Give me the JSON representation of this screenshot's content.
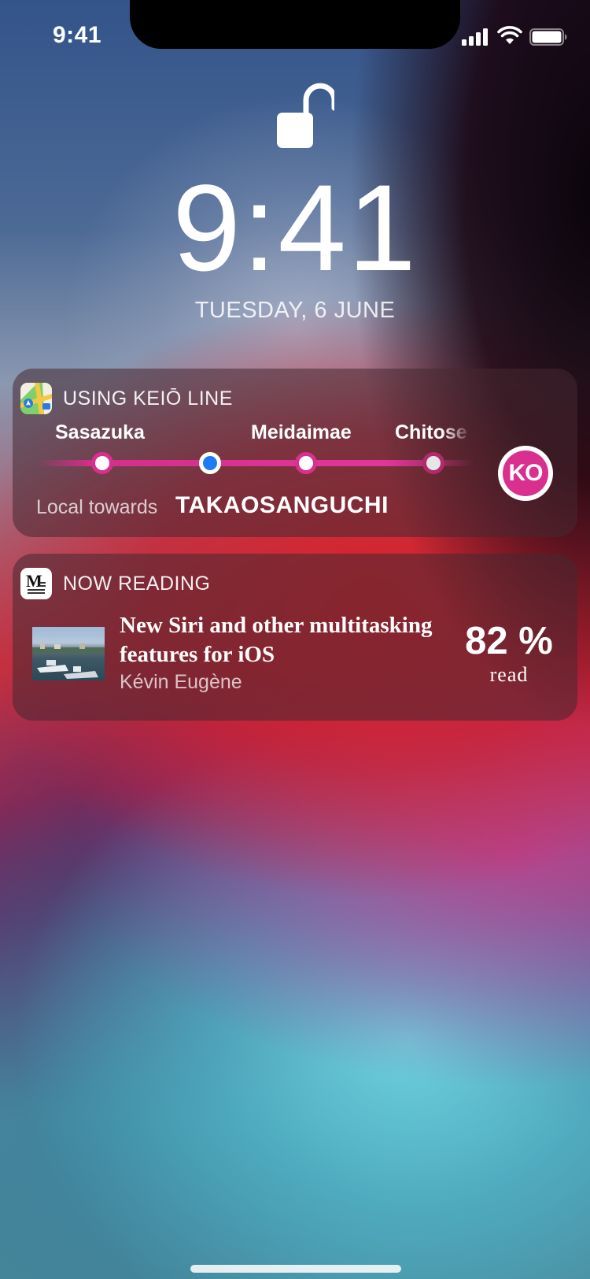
{
  "status_bar": {
    "time": "9:41",
    "signal_icon": "cellular-signal-icon",
    "wifi_icon": "wifi-icon",
    "battery_icon": "battery-icon"
  },
  "lock_screen": {
    "lock_icon": "unlocked-padlock-icon",
    "time": "9:41",
    "date": "TUESDAY, 6 JUNE"
  },
  "transit_widget": {
    "app_icon": "maps-app-icon",
    "title": "USING KEIŌ LINE",
    "stations": [
      "Sasazuka",
      "Meidaimae",
      "Chitose"
    ],
    "line_badge": "KO",
    "line_color": "#d92f8e",
    "current_stop_color": "#1e7bf5",
    "towards_label": "Local towards",
    "destination": "TAKAOSANGUCHI"
  },
  "reading_widget": {
    "app_icon": "medium-app-icon",
    "app_icon_letter": "M",
    "title": "NOW READING",
    "article_title": "New Siri and other multitasking features for iOS",
    "author": "Kévin Eugène",
    "percent": "82 %",
    "percent_label": "read"
  }
}
